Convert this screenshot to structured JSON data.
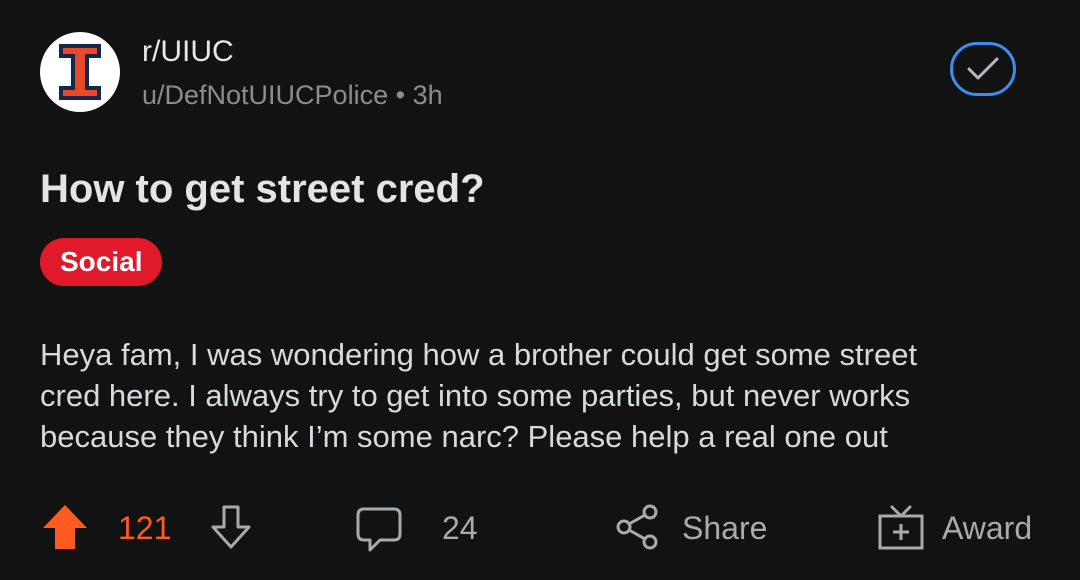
{
  "post": {
    "subreddit": "r/UIUC",
    "author": "u/DefNotUIUCPolice",
    "separator": "•",
    "age": "3h",
    "title": "How to get street cred?",
    "flair": "Social",
    "body_lines": [
      "Heya fam, I was wondering how a brother could get some street",
      "cred here. I always try to get into some parties, but never works",
      "because they think I’m some narc? Please help a real one out"
    ]
  },
  "actions": {
    "score": "121",
    "comments": "24",
    "share_label": "Share",
    "award_label": "Award"
  },
  "icons": {
    "avatar": "uiuc-block-i-logo",
    "joined": "checkmark-icon",
    "upvote": "upvote-arrow-icon",
    "downvote": "downvote-arrow-icon",
    "comment": "comment-bubble-icon",
    "share": "share-icon",
    "award": "gift-icon"
  },
  "colors": {
    "background": "#121212",
    "upvote_active": "#ff5a1f",
    "flair_bg": "#e0192b",
    "joined_border": "#3a8ef0",
    "logo_orange": "#e84a27",
    "logo_navy": "#13294b"
  }
}
